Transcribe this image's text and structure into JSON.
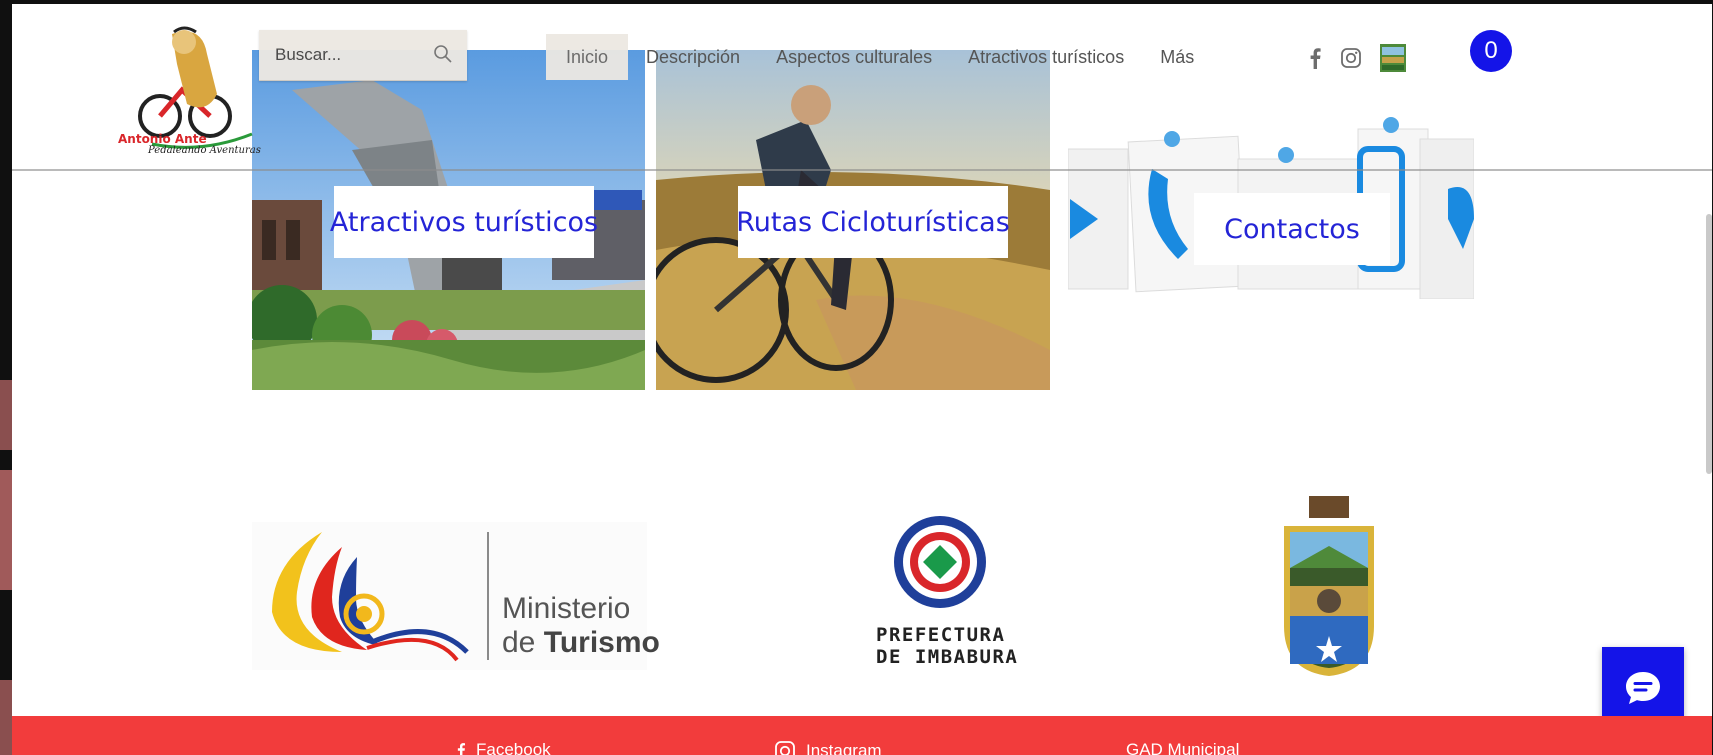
{
  "brand": {
    "logo_name": "Antonio Ante",
    "logo_tagline": "Pedaleando Aventuras"
  },
  "search": {
    "placeholder": "Buscar..."
  },
  "nav": {
    "items": [
      {
        "label": "Inicio",
        "active": true
      },
      {
        "label": "Descripción",
        "active": false
      },
      {
        "label": "Aspectos culturales",
        "active": false
      },
      {
        "label": "Atractivos turísticos",
        "active": false
      },
      {
        "label": "Más",
        "active": false
      }
    ]
  },
  "social": {
    "icons": [
      "facebook-icon",
      "instagram-icon",
      "site-thumbnail-icon"
    ]
  },
  "cart": {
    "count": "0"
  },
  "cards": [
    {
      "label": "Atractivos turísticos"
    },
    {
      "label": "Rutas Cicloturísticas"
    },
    {
      "label": "Contactos"
    }
  ],
  "partners": {
    "ministerio_line1": "Ministerio",
    "ministerio_line2_prefix": "de",
    "ministerio_line2_bold": "Turismo",
    "prefectura_line1": "PREFECTURA",
    "prefectura_line2": "DE IMBABURA"
  },
  "footer": {
    "links": [
      {
        "label": "Facebook",
        "icon": "facebook-icon"
      },
      {
        "label": "Instagram",
        "icon": "instagram-icon"
      },
      {
        "label": "GAD Municipal",
        "icon": ""
      }
    ]
  },
  "colors": {
    "accent_blue": "#1414e8",
    "footer_red": "#f23c3c",
    "label_text": "#2424d6"
  }
}
